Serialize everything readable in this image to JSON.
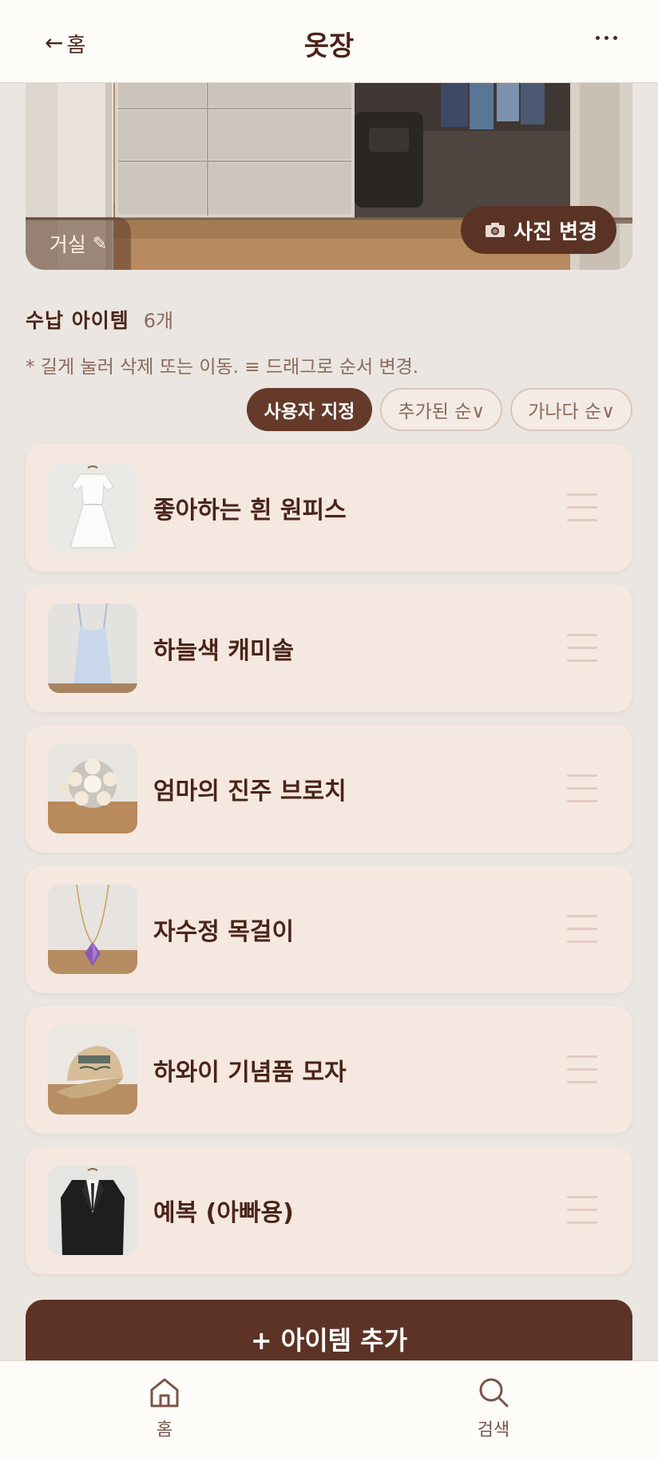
{
  "header": {
    "back_label": "홈",
    "back_arrow": "←",
    "title": "옷장",
    "more_icon": "more-horizontal-icon"
  },
  "hero": {
    "room_label": "거실",
    "edit_icon": "✎",
    "change_photo_label": "사진 변경"
  },
  "section": {
    "title": "수납 아이템",
    "count": "6개",
    "hint": "* 길게 눌러 삭제 또는 이동. ≡ 드래그로 순서 변경."
  },
  "sort": {
    "options": [
      "사용자 지정",
      "추가된 순∨",
      "가나다 순∨"
    ],
    "active_index": 0
  },
  "items": [
    {
      "name": "좋아하는 흰 원피스",
      "thumb": "white-dress"
    },
    {
      "name": "하늘색 캐미솔",
      "thumb": "blue-camisole"
    },
    {
      "name": "엄마의 진주 브로치",
      "thumb": "pearl-brooch"
    },
    {
      "name": "자수정 목걸이",
      "thumb": "amethyst-necklace"
    },
    {
      "name": "하와이 기념품 모자",
      "thumb": "hawaii-cap"
    },
    {
      "name": "예복 (아빠용)",
      "thumb": "black-suit"
    }
  ],
  "add_button": {
    "label": "+ 아이템 추가"
  },
  "nav": {
    "home_label": "홈",
    "search_label": "검색"
  },
  "colors": {
    "accent": "#5c3324",
    "text": "#4a2418",
    "card": "#f5e8e1",
    "background": "#ebe6e1"
  }
}
